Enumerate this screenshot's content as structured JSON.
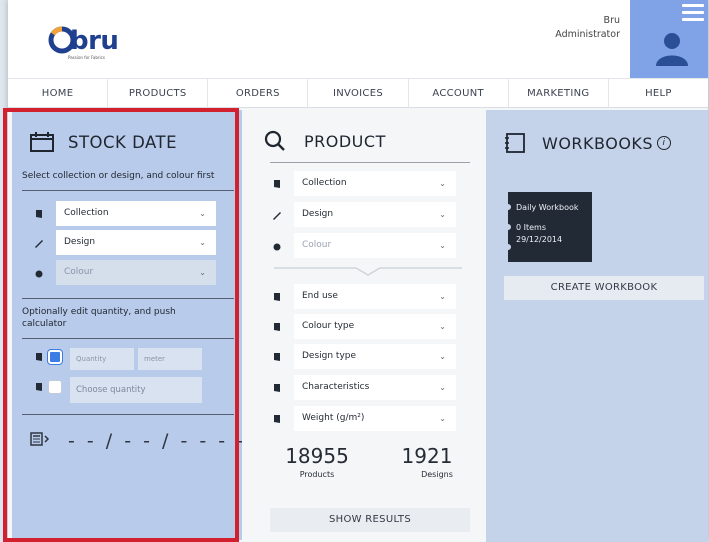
{
  "header": {
    "logo_text": "bru",
    "logo_tagline": "Passion for Fabrics",
    "user_name": "Bru",
    "user_role": "Administrator"
  },
  "nav": [
    "HOME",
    "PRODUCTS",
    "ORDERS",
    "INVOICES",
    "ACCOUNT",
    "MARKETING",
    "HELP"
  ],
  "stock_date": {
    "title": "STOCK DATE",
    "hint1": "Select collection or design, and colour first",
    "collection": "Collection",
    "design": "Design",
    "colour": "Colour",
    "hint2": "Optionally edit quantity, and push calculator",
    "quantity_placeholder": "Quantity",
    "unit_placeholder": "meter",
    "choose_quantity": "Choose quantity",
    "date": "- - / - - / - - - -"
  },
  "product": {
    "title": "PRODUCT",
    "collection": "Collection",
    "design": "Design",
    "colour": "Colour",
    "end_use": "End use",
    "colour_type": "Colour type",
    "design_type": "Design type",
    "characteristics": "Characteristics",
    "weight": "Weight (g/m²)",
    "products_count": "18955",
    "products_label": "Products",
    "designs_count": "1921",
    "designs_label": "Designs",
    "show_results": "SHOW RESULTS"
  },
  "workbooks": {
    "title": "WORKBOOKS",
    "card_title": "Daily Workbook",
    "card_items": "0 Items",
    "card_date": "29/12/2014",
    "create_button": "CREATE WORKBOOK"
  },
  "colors": {
    "stock_bg": "#b9cbea",
    "workbook_bg": "#c5d3ea",
    "highlight": "#d3202f",
    "brand": "#1f3f8f",
    "avatar_bg": "#7fa3e6"
  }
}
